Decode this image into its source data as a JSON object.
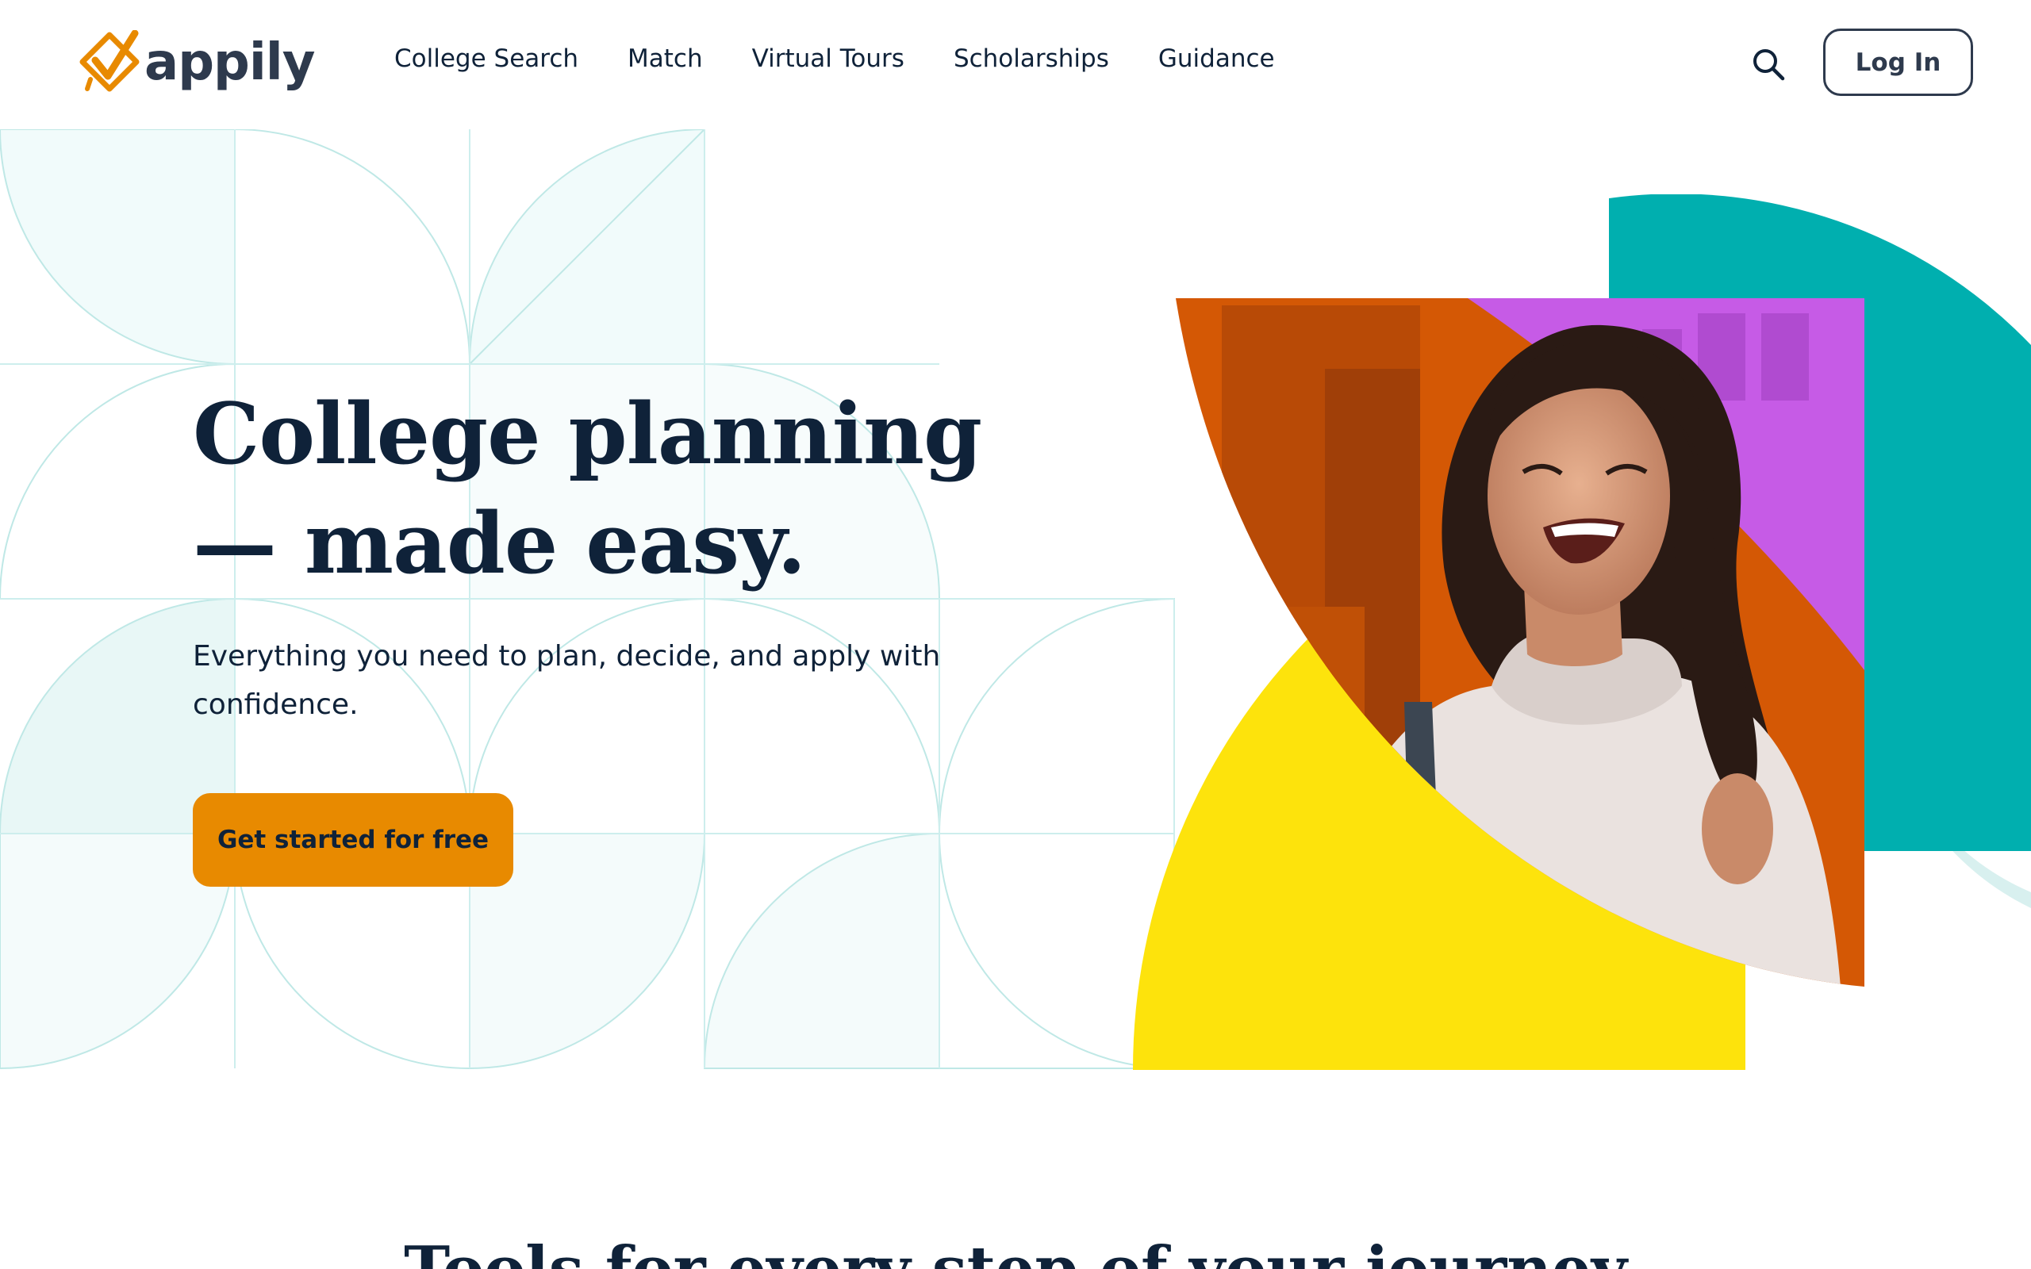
{
  "brand": {
    "name": "appily",
    "accent": "#e88a00",
    "navy": "#0f2239",
    "teal": "#00afaf",
    "yellow": "#fde30c",
    "orange": "#d95a05",
    "purple": "#c65be6"
  },
  "nav": {
    "items": [
      {
        "label": "College Search"
      },
      {
        "label": "Match"
      },
      {
        "label": "Virtual Tours"
      },
      {
        "label": "Scholarships"
      },
      {
        "label": "Guidance"
      }
    ],
    "search_icon": "search-icon",
    "login_label": "Log In"
  },
  "hero": {
    "title_line1": "College planning",
    "title_line2": "— made easy.",
    "subtitle": "Everything you need to plan, decide, and apply with confidence.",
    "cta_label": "Get started for free",
    "image_alt": "Smiling student with backpack"
  },
  "tools": {
    "title": "Tools for every step of your journey"
  }
}
